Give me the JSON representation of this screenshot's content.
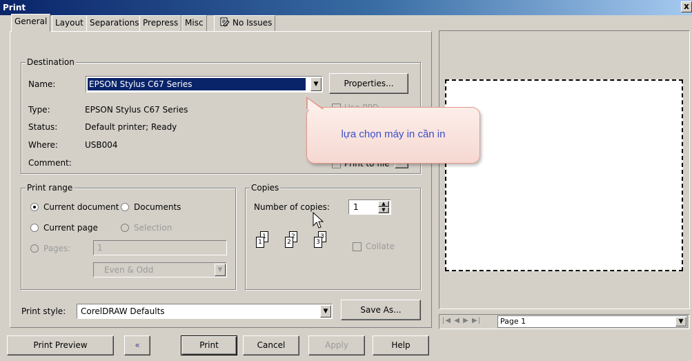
{
  "window": {
    "title": "Print",
    "close_glyph": "x"
  },
  "tabs": [
    {
      "label": "General",
      "active": true
    },
    {
      "label": "Layout"
    },
    {
      "label": "Separations"
    },
    {
      "label": "Prepress"
    },
    {
      "label": "Misc"
    },
    {
      "label": "No Issues",
      "icon": "issues-icon"
    }
  ],
  "destination": {
    "legend": "Destination",
    "name_label": "Name:",
    "name_value": "EPSON Stylus C67 Series",
    "properties_button": "Properties...",
    "type_label": "Type:",
    "type_value": "EPSON Stylus C67 Series",
    "status_label": "Status:",
    "status_value": "Default printer; Ready",
    "where_label": "Where:",
    "where_value": "USB004",
    "comment_label": "Comment:",
    "use_ppd_label": "Use PPD",
    "print_to_file_label": "Print to file"
  },
  "callout": {
    "text": "lựa chọn máy in cần in"
  },
  "print_range": {
    "legend": "Print range",
    "current_document": "Current document",
    "documents": "Documents",
    "current_page": "Current page",
    "selection": "Selection",
    "pages_label": "Pages:",
    "pages_value": "1",
    "page_set": "Even & Odd"
  },
  "copies": {
    "legend": "Copies",
    "number_label": "Number of copies:",
    "number_value": "1",
    "collate_label": "Collate",
    "collate_pages": [
      "1",
      "2",
      "3"
    ]
  },
  "print_style": {
    "label": "Print style:",
    "value": "CorelDRAW Defaults",
    "save_as_button": "Save As..."
  },
  "buttons": {
    "print_preview": "Print Preview",
    "collapse_glyph": "«",
    "print": "Print",
    "cancel": "Cancel",
    "apply": "Apply",
    "help": "Help"
  },
  "preview": {
    "page_value": "Page 1"
  },
  "colors": {
    "face": "#d4d0c8",
    "selection": "#0a246a",
    "callout_text": "#3a4ec8"
  }
}
